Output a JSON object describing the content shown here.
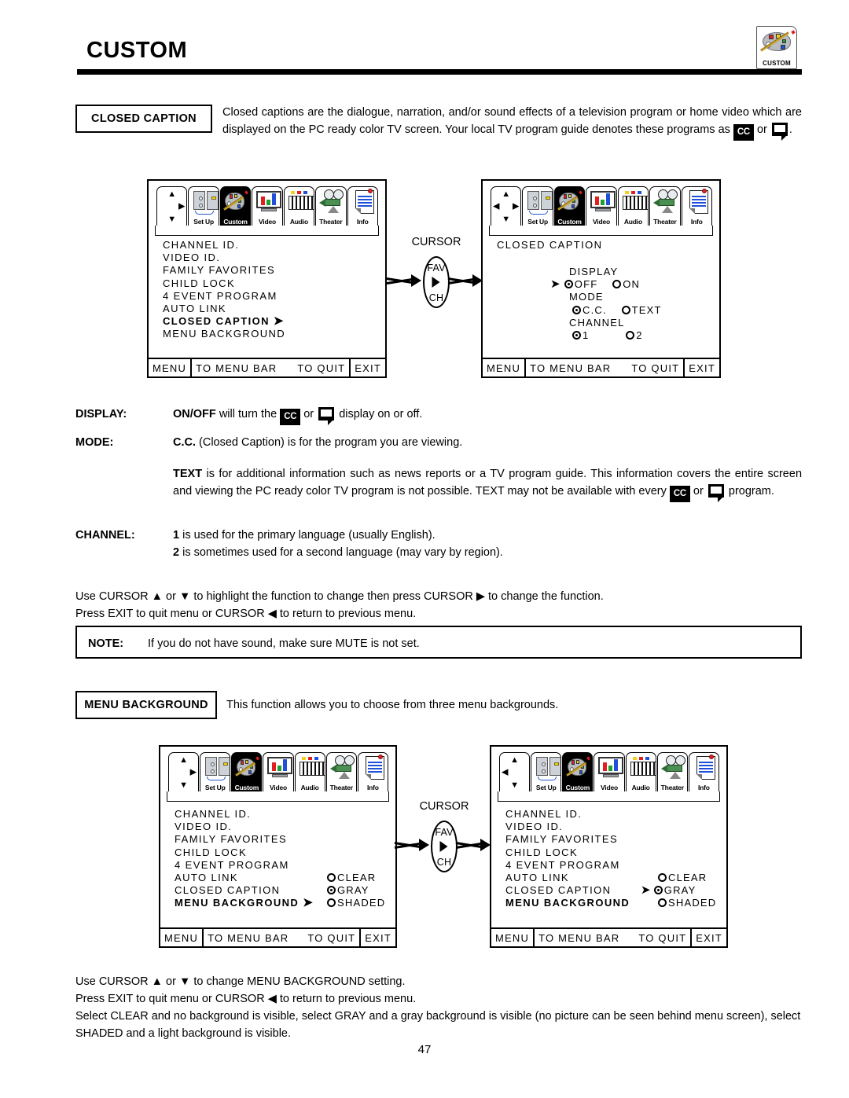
{
  "header": {
    "title": "CUSTOM",
    "corner_logo_label": "CUSTOM",
    "corner_logo_icon": "palette-icon"
  },
  "closed_caption_section": {
    "label": "CLOSED CAPTION",
    "intro_part1": "Closed captions are the dialogue, narration, and/or sound effects of a television program or home video which are displayed on the PC ready color TV screen.  Your local TV program guide denotes these programs as",
    "cc_badge": "CC",
    "or_word": "or",
    "period": ".",
    "cursor_label": "CURSOR",
    "favch": {
      "fav": "FAV",
      "ch": "CH"
    }
  },
  "osd_menu_bar": {
    "tabs": [
      {
        "label": "",
        "icon": "cursor-pad-icon"
      },
      {
        "label": "Set Up",
        "icon": "setup-panel-icon"
      },
      {
        "label": "Custom",
        "icon": "palette-icon",
        "selected": true
      },
      {
        "label": "Video",
        "icon": "tv-bars-icon"
      },
      {
        "label": "Audio",
        "icon": "keyboard-icon"
      },
      {
        "label": "Theater",
        "icon": "projector-icon"
      },
      {
        "label": "Info",
        "icon": "document-icon"
      }
    ]
  },
  "osd_footer": {
    "menu": "MENU",
    "to_menu_bar": "TO MENU BAR",
    "to_quit": "TO QUIT",
    "exit": "EXIT"
  },
  "osd_screen_1": {
    "items": [
      {
        "label": "CHANNEL ID.",
        "highlighted": false,
        "arrow": false
      },
      {
        "label": "VIDEO ID.",
        "highlighted": false,
        "arrow": false
      },
      {
        "label": "FAMILY FAVORITES",
        "highlighted": false,
        "arrow": false
      },
      {
        "label": "CHILD LOCK",
        "highlighted": false,
        "arrow": false
      },
      {
        "label": "4 EVENT PROGRAM",
        "highlighted": false,
        "arrow": false
      },
      {
        "label": "AUTO LINK",
        "highlighted": false,
        "arrow": false
      },
      {
        "label": "CLOSED CAPTION",
        "highlighted": true,
        "arrow": true
      },
      {
        "label": "MENU BACKGROUND",
        "highlighted": false,
        "arrow": false
      }
    ]
  },
  "osd_screen_2": {
    "title": "CLOSED CAPTION",
    "groups": [
      {
        "name": "DISPLAY",
        "pointer": true,
        "options": [
          {
            "label": "OFF",
            "selected": true
          },
          {
            "label": "ON",
            "selected": false
          }
        ]
      },
      {
        "name": "MODE",
        "pointer": false,
        "options": [
          {
            "label": "C.C.",
            "selected": true
          },
          {
            "label": "TEXT",
            "selected": false
          }
        ]
      },
      {
        "name": "CHANNEL",
        "pointer": false,
        "options": [
          {
            "label": "1",
            "selected": true
          },
          {
            "label": "2",
            "selected": false
          }
        ]
      }
    ]
  },
  "descriptions": {
    "display_label": "DISPLAY:",
    "display_text_a": "ON/OFF",
    "display_text_b": "will turn the",
    "display_text_c": "or",
    "display_text_d": "display on or off.",
    "mode_label": "MODE:",
    "mode_text_a": "C.C.",
    "mode_text_b": "(Closed Caption) is for the program you are viewing.",
    "text_para_a": "TEXT",
    "text_para_b": "is for additional information such as news reports or a TV program guide.  This information covers the entire screen and viewing the PC ready color TV program is not possible.  TEXT may not be available with every",
    "text_para_c": "or",
    "text_para_d": "program.",
    "channel_label": "CHANNEL:",
    "channel_line1_a": "1",
    "channel_line1_b": "is used for the primary language (usually English).",
    "channel_line2_a": "2",
    "channel_line2_b": "is sometimes used for a second language (may vary by region)."
  },
  "cc_instructions": {
    "line1": "Use CURSOR ▲ or ▼ to highlight the function to change then press CURSOR ▶ to change the function.",
    "line2": "Press EXIT to quit menu or CURSOR ◀ to return to previous menu."
  },
  "note": {
    "label": "NOTE:",
    "text": "If you do not have sound, make sure MUTE is not set."
  },
  "menu_background_section": {
    "label": "MENU BACKGROUND",
    "description": "This function allows you to choose from three menu backgrounds.",
    "cursor_label": "CURSOR",
    "favch": {
      "fav": "FAV",
      "ch": "CH"
    }
  },
  "osd_screen_3": {
    "items": [
      {
        "label": "CHANNEL ID.",
        "highlighted": false,
        "arrow": false
      },
      {
        "label": "VIDEO ID.",
        "highlighted": false,
        "arrow": false
      },
      {
        "label": "FAMILY FAVORITES",
        "highlighted": false,
        "arrow": false
      },
      {
        "label": "CHILD LOCK",
        "highlighted": false,
        "arrow": false
      },
      {
        "label": "4 EVENT PROGRAM",
        "highlighted": false,
        "arrow": false
      },
      {
        "label": "AUTO LINK",
        "highlighted": false,
        "arrow": false
      },
      {
        "label": "CLOSED CAPTION",
        "highlighted": false,
        "arrow": false
      },
      {
        "label": "MENU BACKGROUND",
        "highlighted": true,
        "arrow": true
      }
    ],
    "options": [
      {
        "label": "CLEAR",
        "selected": false,
        "pointer": false
      },
      {
        "label": "GRAY",
        "selected": true,
        "pointer": false
      },
      {
        "label": "SHADED",
        "selected": false,
        "pointer": false
      }
    ]
  },
  "osd_screen_4": {
    "items": [
      {
        "label": "CHANNEL ID.",
        "highlighted": false,
        "arrow": false
      },
      {
        "label": "VIDEO ID.",
        "highlighted": false,
        "arrow": false
      },
      {
        "label": "FAMILY FAVORITES",
        "highlighted": false,
        "arrow": false
      },
      {
        "label": "CHILD LOCK",
        "highlighted": false,
        "arrow": false
      },
      {
        "label": "4 EVENT PROGRAM",
        "highlighted": false,
        "arrow": false
      },
      {
        "label": "AUTO LINK",
        "highlighted": false,
        "arrow": false
      },
      {
        "label": "CLOSED CAPTION",
        "highlighted": false,
        "arrow": false
      },
      {
        "label": "MENU BACKGROUND",
        "highlighted": true,
        "arrow": false
      }
    ],
    "options": [
      {
        "label": "CLEAR",
        "selected": false,
        "pointer": false
      },
      {
        "label": "GRAY",
        "selected": true,
        "pointer": true
      },
      {
        "label": "SHADED",
        "selected": false,
        "pointer": false
      }
    ]
  },
  "mb_instructions": {
    "line1": "Use CURSOR ▲ or ▼ to change MENU BACKGROUND setting.",
    "line2": "Press EXIT to quit menu or CURSOR ◀ to return to previous menu.",
    "line3": "Select CLEAR and no background is visible, select GRAY and a gray background is visible (no picture can be seen behind menu screen), select SHADED and a light background is visible."
  },
  "page_number": "47"
}
